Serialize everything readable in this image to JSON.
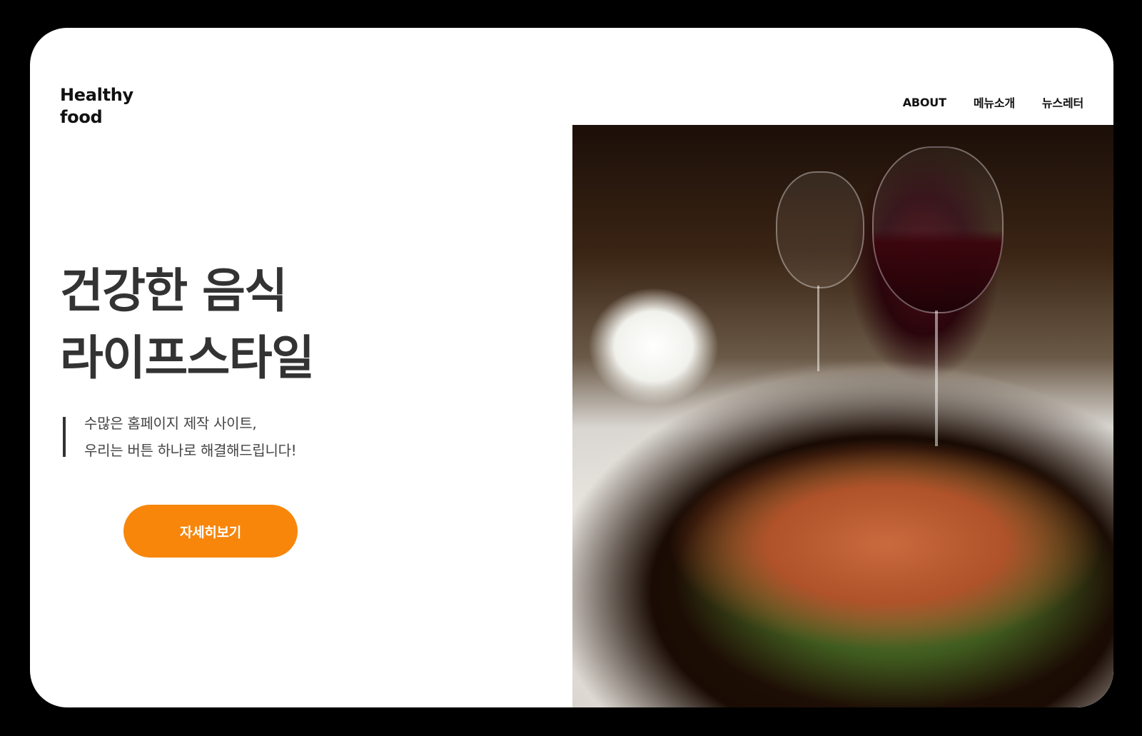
{
  "header": {
    "logo_line1": "Healthy",
    "logo_line2": "food",
    "nav": {
      "about": "ABOUT",
      "menu": "메뉴소개",
      "newsletter": "뉴스레터"
    }
  },
  "hero": {
    "title_line1": "건강한 음식",
    "title_line2": "라이프스타일",
    "quote_line1": "수많은 홈페이지 제작 사이트,",
    "quote_line2": "우리는 버튼 하나로 해결해드립니다!",
    "cta_label": "자세히보기",
    "image_alt": "연어 스테이크 요리 사진"
  },
  "colors": {
    "accent": "#f7860b",
    "title": "#333333",
    "text": "#444444",
    "frame": "#000000",
    "background": "#ffffff"
  }
}
